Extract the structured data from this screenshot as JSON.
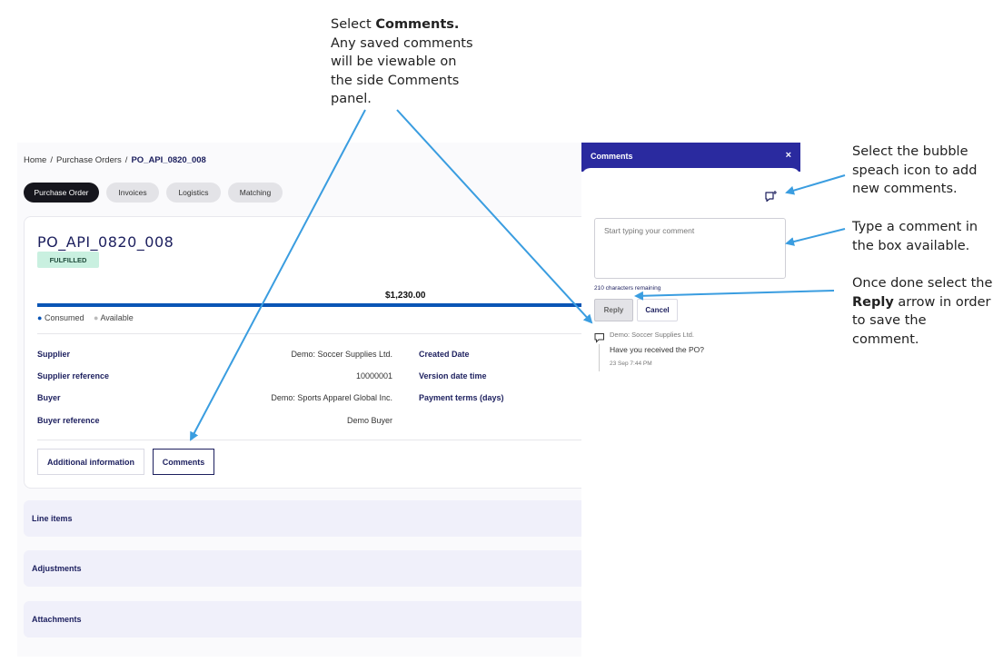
{
  "annotations": {
    "top": {
      "pre": "Select ",
      "bold": "Comments.",
      "post": "\nAny saved comments\nwill be viewable on\nthe side Comments\npanel."
    },
    "right1": {
      "text": "Select the bubble\nspeach icon to add\nnew comments."
    },
    "right2": {
      "text": "Type a comment in\nthe box available."
    },
    "right3": {
      "pre": "Once done select the\n",
      "bold": "Reply",
      "post": " arrow in order\nto save the comment."
    }
  },
  "breadcrumb": {
    "home": "Home",
    "sep": "/",
    "purchase_orders": "Purchase Orders",
    "current": "PO_API_0820_008"
  },
  "tabs": [
    {
      "label": "Purchase Order",
      "active": true
    },
    {
      "label": "Invoices",
      "active": false
    },
    {
      "label": "Logistics",
      "active": false
    },
    {
      "label": "Matching",
      "active": false
    }
  ],
  "po": {
    "title": "PO_API_0820_008",
    "status": "FULFILLED",
    "amount": "$1,230.00",
    "consumed_fraction": 1.0,
    "legend_consumed": "Consumed",
    "legend_available": "Available",
    "fields": [
      {
        "label": "Supplier",
        "value": "Demo: Soccer Supplies Ltd."
      },
      {
        "label": "Supplier reference",
        "value": "10000001"
      },
      {
        "label": "Buyer",
        "value": "Demo: Sports Apparel Global Inc."
      },
      {
        "label": "Buyer reference",
        "value": "Demo Buyer"
      }
    ],
    "right_fields": [
      "Created Date",
      "Version date time",
      "Payment terms (days)"
    ],
    "additional_info_label": "Additional information",
    "comments_label": "Comments"
  },
  "sections": [
    "Line items",
    "Adjustments",
    "Attachments"
  ],
  "panel": {
    "title": "Comments",
    "close": "×",
    "placeholder": "Start typing your comment",
    "chars_remaining": "210 characters remaining",
    "reply": "Reply",
    "cancel": "Cancel",
    "comment": {
      "author": "Demo: Soccer Supplies Ltd.",
      "text": "Have you received the PO?",
      "time": "23 Sep 7:44 PM"
    }
  },
  "colors": {
    "panel_header": "#2a2a9f",
    "arrow": "#3a9de0",
    "progress": "#0a55b5",
    "badge": "#c9f0e0"
  }
}
